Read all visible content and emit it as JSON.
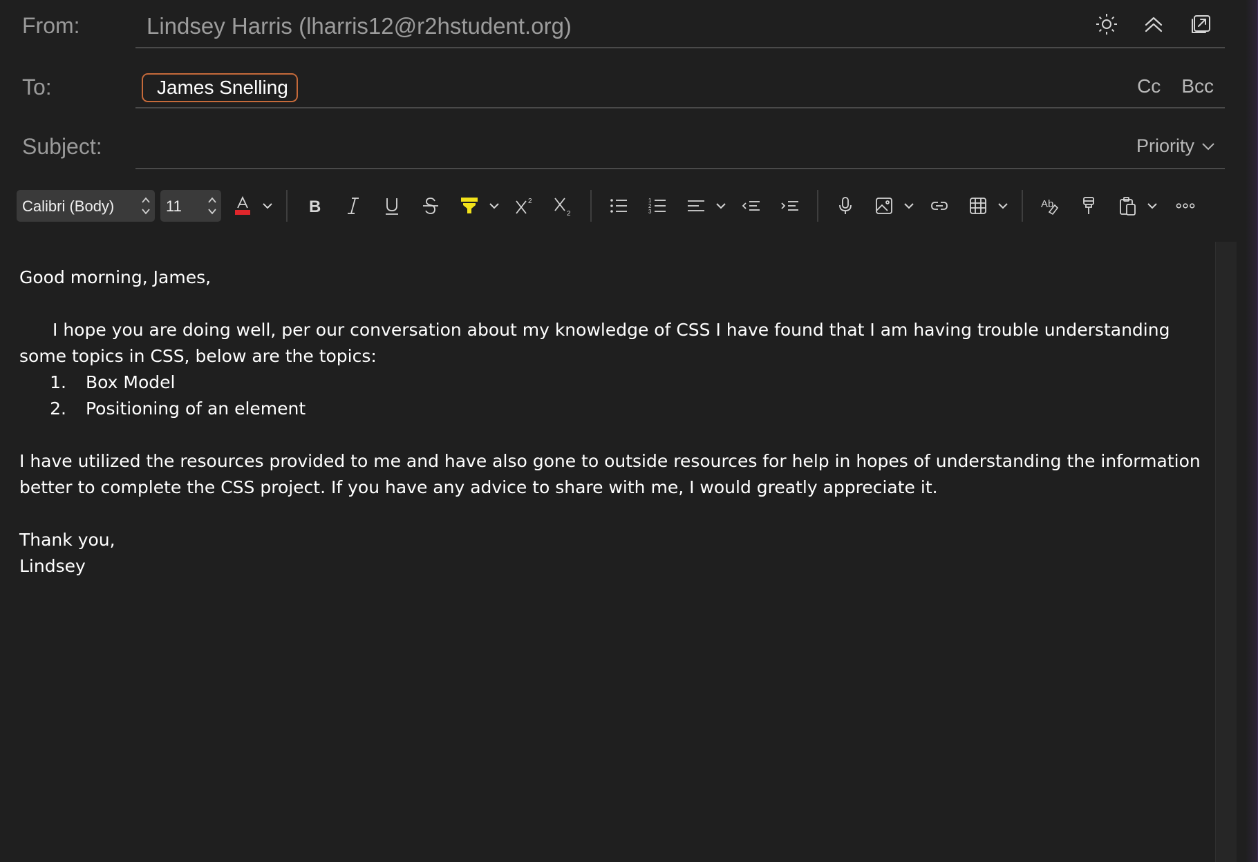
{
  "header": {
    "from_label": "From:",
    "from_value": "Lindsey Harris (lharris12@r2hstudent.org)",
    "to_label": "To:",
    "recipient": "James Snelling",
    "cc_label": "Cc",
    "bcc_label": "Bcc",
    "subject_label": "Subject:",
    "subject_value": "",
    "priority_label": "Priority"
  },
  "toolbar": {
    "font_family": "Calibri (Body)",
    "font_size": "11",
    "font_color": "#e0262b",
    "highlight_color": "#f2e21a"
  },
  "body": {
    "greeting": "Good morning, James,",
    "paragraph1": "I hope you are doing well, per our conversation about my knowledge of CSS I have found that I am having trouble understanding some topics in CSS, below are the topics:",
    "topics": [
      {
        "num": "1.",
        "text": "Box Model"
      },
      {
        "num": "2.",
        "text": "Positioning of an element"
      }
    ],
    "paragraph2": "I have utilized the resources provided to me and have also gone to outside resources for help in hopes of understanding the information better to complete the CSS project. If you have any advice to share with me, I would greatly appreciate it.",
    "closing": "Thank you,",
    "signature": "Lindsey"
  }
}
